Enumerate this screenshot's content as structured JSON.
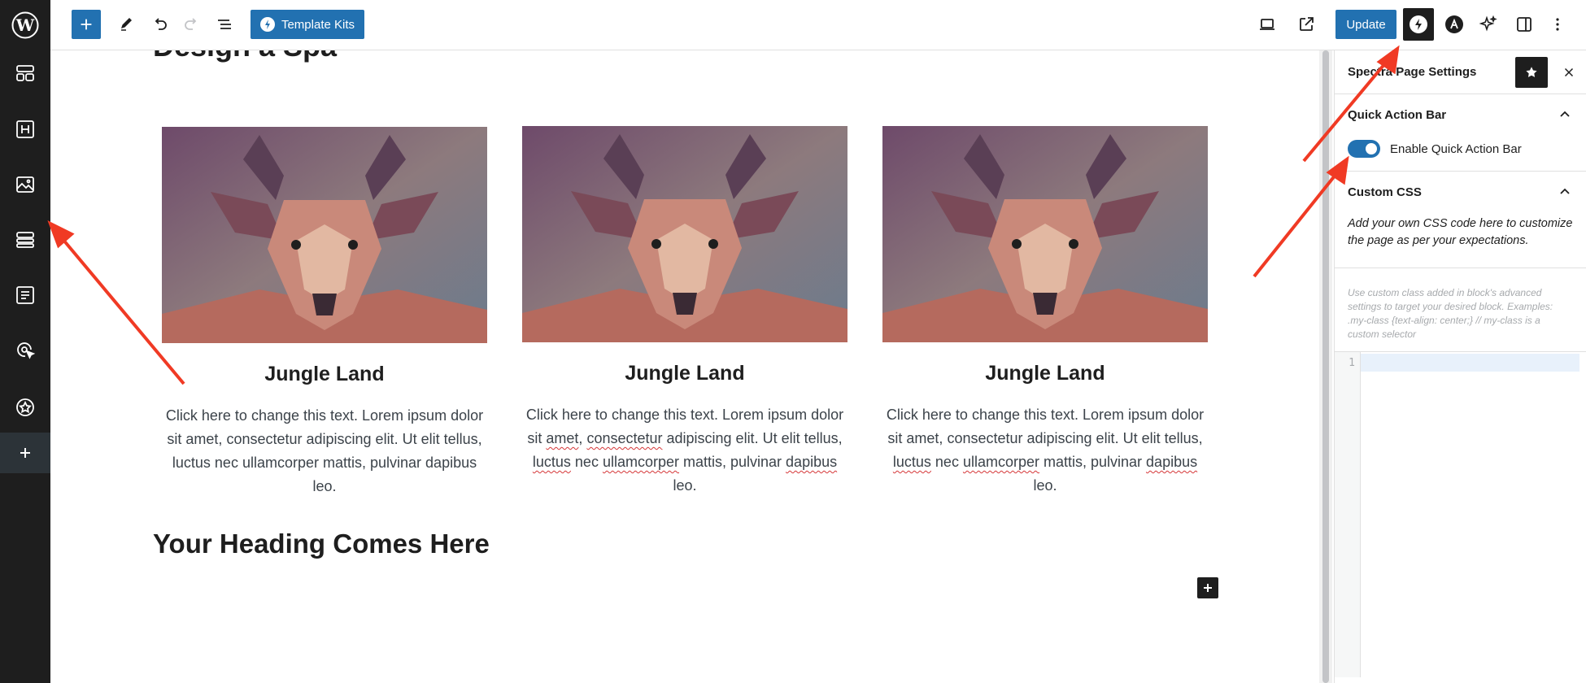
{
  "toolbar": {
    "template_kits_label": "Template Kits",
    "update_label": "Update"
  },
  "canvas": {
    "partial_heading": "Design a Spa",
    "cards": [
      {
        "title": "Jungle Land",
        "text_parts": [
          "Click here to change this text. Lorem ipsum dolor sit amet, consectetur adipiscing elit. Ut elit tellus, luctus nec ullamcorper mattis, pulvinar dapibus leo."
        ]
      },
      {
        "title": "Jungle Land"
      },
      {
        "title": "Jungle Land"
      }
    ],
    "card_text_a": "Click here to change this text. Lorem ipsum dolor sit ",
    "card_text_amet": "amet",
    "card_text_b": ", ",
    "card_text_consectetur": "consectetur",
    "card_text_c": " adipiscing elit. Ut elit tellus, ",
    "card_text_luctus": "luctus",
    "card_text_d": " nec ",
    "card_text_ullamcorper": "ullamcorper",
    "card_text_e": " mattis, pulvinar ",
    "card_text_dapibus": "dapibus",
    "card_text_f": " leo.",
    "heading": "Your Heading Comes Here"
  },
  "sidebar": {
    "title": "Spectra Page Settings",
    "quick_action": {
      "label": "Quick Action Bar",
      "toggle_label": "Enable Quick Action Bar",
      "enabled": true
    },
    "custom_css": {
      "label": "Custom CSS",
      "description": "Add your own CSS code here to customize the page as per your expectations.",
      "help": "Use custom class added in block's advanced settings to target your desired block. Examples: .my-class {text-align: center;} // my-class is a custom selector",
      "line_number": "1"
    }
  },
  "colors": {
    "accent": "#2271b1",
    "dark": "#1e1e1e",
    "arrow": "#f03a24"
  }
}
